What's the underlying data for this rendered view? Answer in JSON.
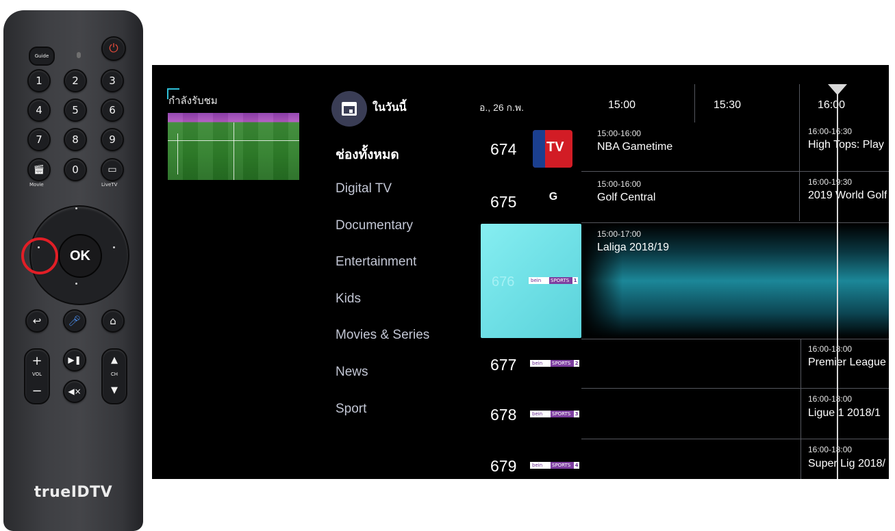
{
  "remote": {
    "guide_label": "Guide",
    "power_glyph": "⏻",
    "digits": [
      "1",
      "2",
      "3",
      "4",
      "5",
      "6",
      "7",
      "8",
      "9",
      "0"
    ],
    "movie_label": "Movie",
    "livetv_label": "LiveTV",
    "ok_label": "OK",
    "vol_label": "VOL",
    "ch_label": "CH",
    "plus": "+",
    "minus": "−",
    "up": "▲",
    "down": "▼",
    "back_glyph": "↩",
    "playpause_glyph": "▶❚",
    "mute_glyph": "◀×",
    "home_glyph": "⌂",
    "brand": "trueIDTV",
    "highlight_color": "#e11e26"
  },
  "guide": {
    "now_watching_label": "กำลังรับชม",
    "today_label": "ในวันนี้",
    "categories": [
      "ช่องทั้งหมด",
      "Digital TV",
      "Documentary",
      "Entertainment",
      "Kids",
      "Movies & Series",
      "News",
      "Sport"
    ],
    "date": "อ., 26 ก.พ.",
    "time_slots": [
      "15:00",
      "15:30",
      "16:00"
    ],
    "channels": [
      {
        "number": "674",
        "logo": "NBA TV",
        "logo_text": "TV"
      },
      {
        "number": "675",
        "logo": "Golf Channel",
        "logo_text": "G"
      },
      {
        "number": "676",
        "logo": "beIN SPORTS 1",
        "logo_text_a": "bein",
        "logo_text_b": "SPORTS",
        "logo_text_c": "1"
      },
      {
        "number": "677",
        "logo": "beIN SPORTS 2",
        "logo_text_a": "bein",
        "logo_text_b": "SPORTS",
        "logo_text_c": "2"
      },
      {
        "number": "678",
        "logo": "beIN SPORTS 3",
        "logo_text_a": "bein",
        "logo_text_b": "SPORTS",
        "logo_text_c": "3"
      },
      {
        "number": "679",
        "logo": "beIN SPORTS 4",
        "logo_text_a": "bein",
        "logo_text_b": "SPORTS",
        "logo_text_c": "4"
      }
    ],
    "programs": [
      {
        "time": "15:00-16:00",
        "title": "NBA Gametime"
      },
      {
        "time": "16:00-16:30",
        "title": "High Tops: Play"
      },
      {
        "time": "15:00-16:00",
        "title": "Golf Central"
      },
      {
        "time": "16:00-19:30",
        "title": "2019 World Golf"
      },
      {
        "time": "15:00-17:00",
        "title": "Laliga 2018/19"
      },
      {
        "time": "16:00-18:00",
        "title": "Premier League"
      },
      {
        "time": "16:00-18:00",
        "title": "Ligue 1 2018/1"
      },
      {
        "time": "16:00-18:00",
        "title": "Super Lig 2018/"
      }
    ],
    "accent_color": "#2fc0d8",
    "selected_color": "#6fe0e6"
  }
}
